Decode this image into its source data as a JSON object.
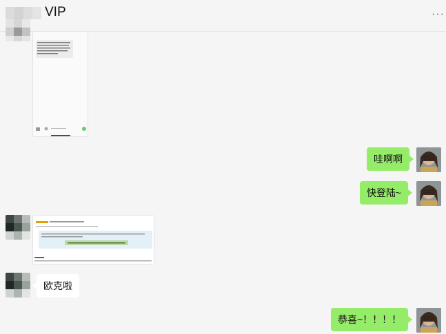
{
  "header": {
    "title": "VIP",
    "more_label": "···"
  },
  "messages": [
    {
      "side": "theirs",
      "type": "image",
      "desc_name": "phone-screenshot-image"
    },
    {
      "side": "mine",
      "type": "text",
      "text": "哇啊啊"
    },
    {
      "side": "mine",
      "type": "text",
      "text": "快登陆~"
    },
    {
      "side": "theirs",
      "type": "image",
      "desc_name": "webpage-screenshot-image"
    },
    {
      "side": "theirs",
      "type": "text",
      "text": "欧克啦"
    },
    {
      "side": "mine",
      "type": "text",
      "text": "恭喜~！！！！"
    }
  ],
  "colors": {
    "mine_bubble": "#95ec69",
    "theirs_bubble": "#ffffff",
    "background": "#f5f5f5"
  }
}
